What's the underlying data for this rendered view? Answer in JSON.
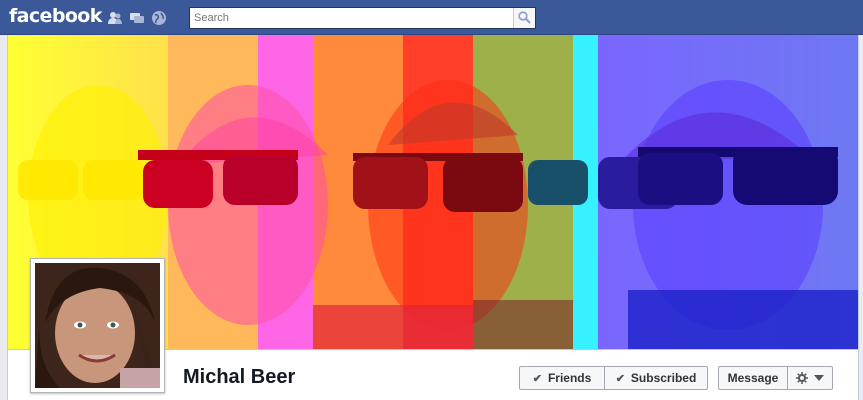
{
  "header": {
    "logo": "facebook",
    "search_placeholder": "Search",
    "jewels": [
      "friend-requests-icon",
      "messages-icon",
      "notifications-icon"
    ]
  },
  "profile": {
    "name": "Michal Beer",
    "cover_description": "cover-photo",
    "actions": {
      "friends_label": "Friends",
      "subscribed_label": "Subscribed",
      "message_label": "Message"
    }
  },
  "colors": {
    "brand_blue": "#3b5998",
    "cover_panels": [
      "#ffff00",
      "#ff9900",
      "#ff00ff",
      "#ff3300",
      "#ff2200",
      "#33aa44",
      "#00ffff",
      "#6633ff",
      "#3344ff"
    ]
  }
}
